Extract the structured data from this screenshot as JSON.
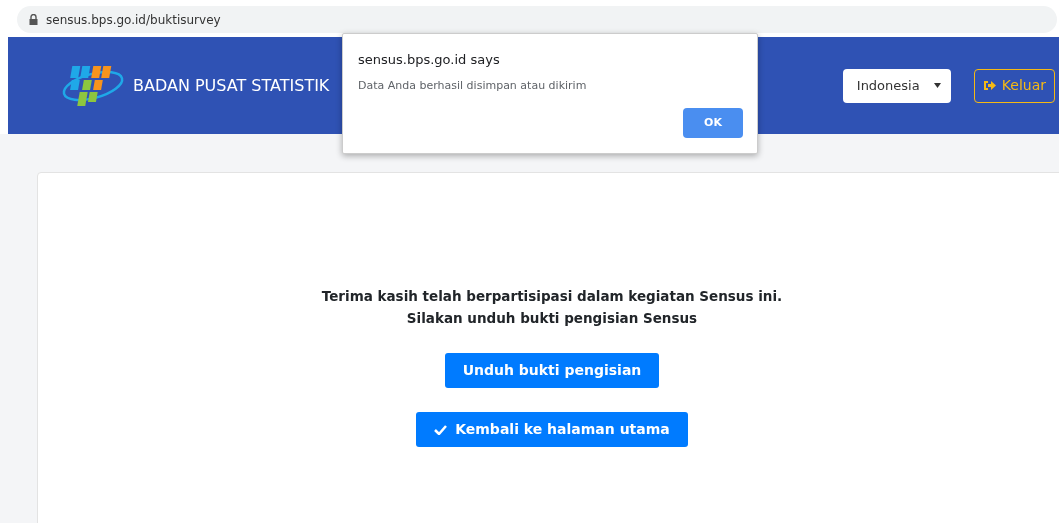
{
  "browser": {
    "url": "sensus.bps.go.id/buktisurvey"
  },
  "header": {
    "brand": "BADAN PUSAT STATISTIK",
    "language": "Indonesia",
    "logout_button": "Keluar"
  },
  "dialog": {
    "title": "sensus.bps.go.id says",
    "message": "Data Anda berhasil disimpan atau dikirim",
    "button": "OK"
  },
  "content": {
    "lines": [
      "Terima kasih telah berpartisipasi dalam kegiatan Sensus ini.",
      "Silakan unduh bukti pengisian Sensus"
    ],
    "buttons": [
      {
        "label": "Unduh bukti pengisian",
        "kind": "plain"
      },
      {
        "label": "Kembali ke halaman utama",
        "kind": "check"
      }
    ]
  }
}
